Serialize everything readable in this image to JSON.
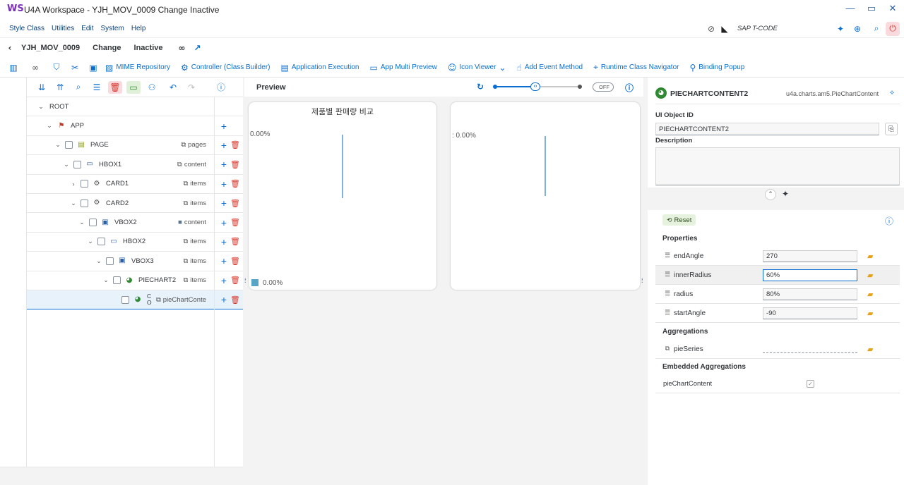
{
  "window": {
    "logo": "WS",
    "title": "U4A Workspace - YJH_MOV_0009 Change Inactive"
  },
  "menu": {
    "items": [
      "Style Class",
      "Utilities",
      "Edit",
      "System",
      "Help"
    ],
    "tcode_placeholder": "SAP T-CODE"
  },
  "path": {
    "app_id": "YJH_MOV_0009",
    "mode": "Change",
    "status": "Inactive"
  },
  "toolbar": {
    "mime": "MIME Repository",
    "controller": "Controller (Class Builder)",
    "app_exec": "Application Execution",
    "multi_preview": "App Multi Preview",
    "icon_viewer": "Icon Viewer",
    "add_event": "Add Event Method",
    "runtime_nav": "Runtime Class Navigator",
    "binding_popup": "Binding Popup"
  },
  "tree": {
    "rows": [
      {
        "name": "ROOT",
        "agg": ""
      },
      {
        "name": "APP",
        "agg": ""
      },
      {
        "name": "PAGE",
        "agg": "pages"
      },
      {
        "name": "HBOX1",
        "agg": "content"
      },
      {
        "name": "CARD1",
        "agg": "items"
      },
      {
        "name": "CARD2",
        "agg": "items"
      },
      {
        "name": "VBOX2",
        "agg": "content"
      },
      {
        "name": "HBOX2",
        "agg": "items"
      },
      {
        "name": "VBOX3",
        "agg": "items"
      },
      {
        "name": "PIECHART2",
        "agg": "items"
      },
      {
        "name": "C\nO",
        "agg": "pieChartConte"
      }
    ]
  },
  "preview": {
    "title": "Preview",
    "toggle": "OFF",
    "card1_title": "제품별 판매량 비교",
    "card1_label_top": "0.00%",
    "card1_legend": "0.00%",
    "card2_label_top": ": 0.00%"
  },
  "details": {
    "object_name": "PIECHARTCONTENT2",
    "object_class": "u4a.charts.am5.PieChartContent",
    "ui_object_id_label": "UI Object ID",
    "ui_object_id": "PIECHARTCONTENT2",
    "description_label": "Description",
    "reset": "Reset",
    "properties_label": "Properties",
    "properties": [
      {
        "name": "endAngle",
        "value": "270"
      },
      {
        "name": "innerRadius",
        "value": "60%"
      },
      {
        "name": "radius",
        "value": "80%"
      },
      {
        "name": "startAngle",
        "value": "-90"
      }
    ],
    "aggregations_label": "Aggregations",
    "aggregation": "pieSeries",
    "embedded_label": "Embedded Aggregations",
    "embedded": "pieChartContent"
  },
  "colors": {
    "accent": "#0a6ed1",
    "delete": "#d9362b",
    "folder": "#e6a118"
  }
}
